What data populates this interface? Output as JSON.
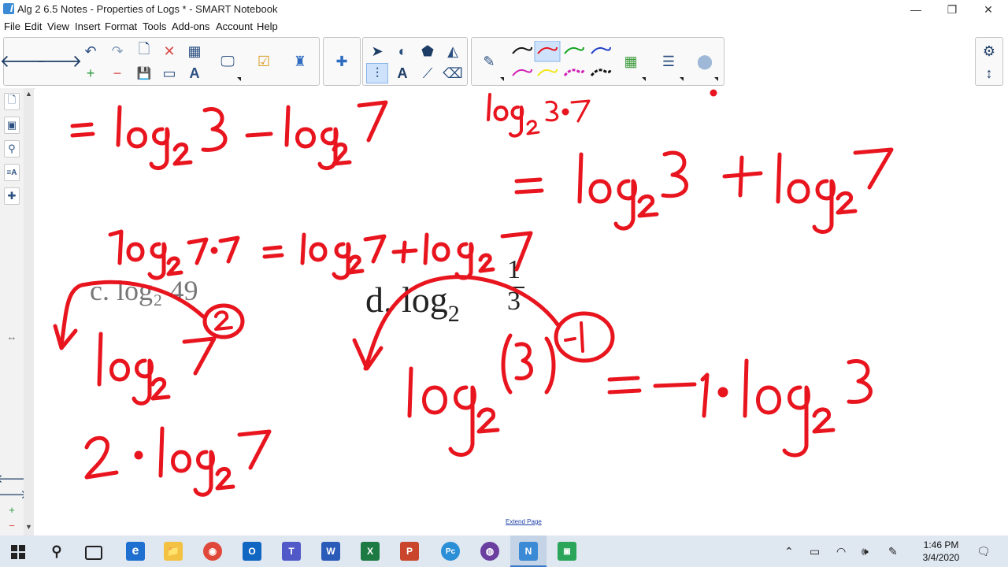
{
  "window": {
    "title": "Alg 2 6.5 Notes - Properties of Logs * - SMART Notebook",
    "minimize": "—",
    "restore": "❐",
    "close": "✕"
  },
  "menu": [
    "File",
    "Edit",
    "View",
    "Insert",
    "Format",
    "Tools",
    "Add-ons",
    "Account",
    "Help"
  ],
  "icons": {
    "back": "🡐",
    "forward": "🡒",
    "undo": "↶",
    "redo": "↷",
    "new_page": "🗋",
    "delete": "✕",
    "table": "▦",
    "screen_capture": "🖵",
    "add_page": "+",
    "delete_page": "−",
    "save": "💾",
    "present": "▭",
    "spell": "A",
    "response": "☑",
    "lab": "♜",
    "addons": "✚",
    "select": "➤",
    "shapes": "◐",
    "eraser_shape": "⬟",
    "fill": "◭",
    "multi_select": "⫶",
    "text": "A",
    "line": "⟋",
    "eraser": "⌫",
    "pen": "✎",
    "color_grid": "▦",
    "properties": "☰",
    "magic": "⬤",
    "settings": "⚙",
    "move": "↕",
    "expand": "↔",
    "prev_page": "🡐",
    "next_page": "🡒"
  },
  "page": {
    "extend_link": "Extend Page",
    "printed_c": "c. log₂ 49",
    "printed_d_prefix": "d. log",
    "printed_d_sub": "2",
    "printed_d_num": "1",
    "printed_d_den": "3"
  },
  "ink_colors": {
    "red": "#e8141e",
    "black": "#111111",
    "green": "#13a320",
    "blue": "#1f3fc6",
    "magenta": "#d11fb6",
    "yellow": "#f2e61a"
  },
  "taskbar": {
    "search": "⚲",
    "apps": [
      "e",
      "📁",
      "◉",
      "O",
      "T",
      "W",
      "X",
      "P",
      "Pc",
      "◍",
      "N",
      "▣"
    ],
    "time": "1:46 PM",
    "date": "3/4/2020"
  }
}
